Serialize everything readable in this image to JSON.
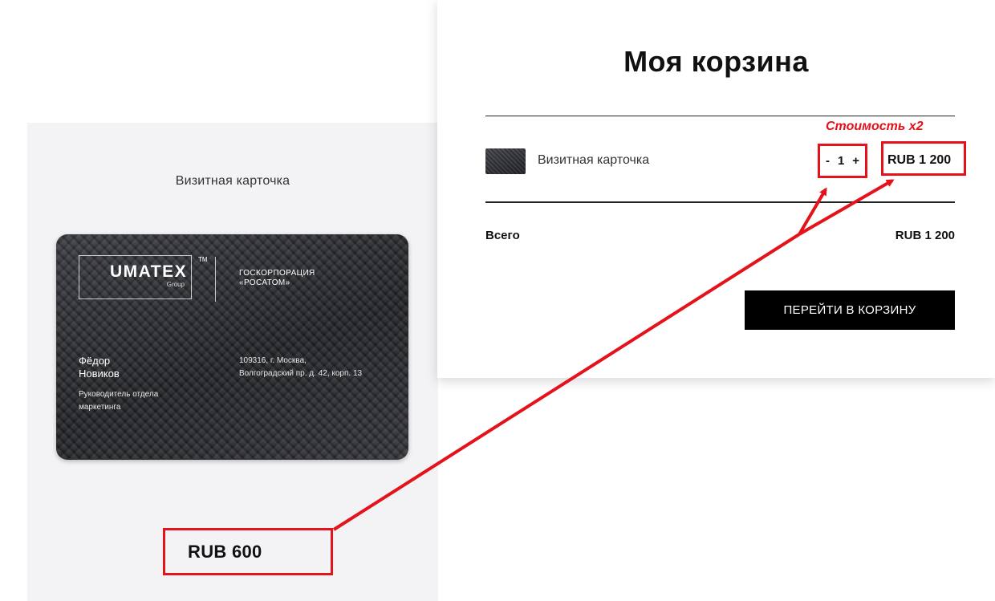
{
  "product": {
    "title": "Визитная карточка",
    "price": "RUB 600",
    "card": {
      "logo": "UMATEX",
      "logo_tm": "TM",
      "logo_sub": "Group",
      "corp_line1": "ГОСКОРПОРАЦИЯ",
      "corp_line2": "«РОСАТОМ»",
      "name_line1": "Фёдор",
      "name_line2": "Новиков",
      "role_line1": "Руководитель отдела",
      "role_line2": "маркетинга",
      "addr_line1": "109316, г. Москва,",
      "addr_line2": "Волгоградский пр. д. 42, корп. 13"
    }
  },
  "cart": {
    "title": "Моя корзина",
    "annotation": "Стоимость х2",
    "item": {
      "name": "Визитная карточка",
      "qty_minus": "-",
      "qty": "1",
      "qty_plus": "+",
      "price": "RUB 1 200"
    },
    "total_label": "Всего",
    "total_value": "RUB 1 200",
    "checkout_label": "ПЕРЕЙТИ В КОРЗИНУ"
  },
  "colors": {
    "annotation_red": "#e4121b",
    "panel_bg": "#f3f3f5",
    "button_bg": "#000000"
  }
}
